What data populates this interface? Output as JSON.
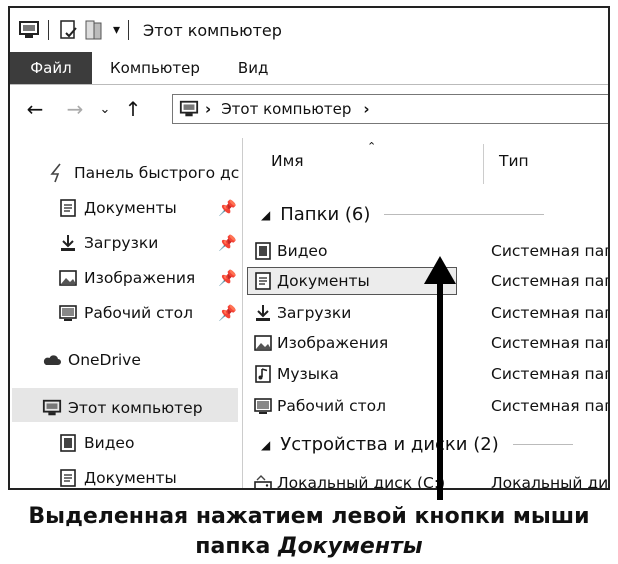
{
  "window": {
    "title": "Этот компьютер",
    "ribbon_tabs": [
      "Файл",
      "Компьютер",
      "Вид"
    ],
    "address": {
      "location": "Этот компьютер",
      "chevron": "›"
    }
  },
  "nav_pane": {
    "quick_access": "Панель быстрого дс",
    "quick_items": [
      {
        "label": "Документы",
        "icon": "documents-icon",
        "pinned": true
      },
      {
        "label": "Загрузки",
        "icon": "downloads-icon",
        "pinned": true
      },
      {
        "label": "Изображения",
        "icon": "pictures-icon",
        "pinned": true
      },
      {
        "label": "Рабочий стол",
        "icon": "desktop-icon",
        "pinned": true
      }
    ],
    "onedrive": "OneDrive",
    "this_pc": "Этот компьютер",
    "pc_items": [
      {
        "label": "Видео",
        "icon": "video-icon"
      },
      {
        "label": "Документы",
        "icon": "documents-icon"
      }
    ]
  },
  "content": {
    "columns": {
      "name": "Имя",
      "type": "Тип"
    },
    "folders_group": "Папки (6)",
    "folders": [
      {
        "name": "Видео",
        "type": "Системная папк",
        "icon": "video-icon",
        "selected": false
      },
      {
        "name": "Документы",
        "type": "Системная папк",
        "icon": "documents-icon",
        "selected": true
      },
      {
        "name": "Загрузки",
        "type": "Системная папк",
        "icon": "downloads-icon",
        "selected": false
      },
      {
        "name": "Изображения",
        "type": "Системная папк",
        "icon": "pictures-icon",
        "selected": false
      },
      {
        "name": "Музыка",
        "type": "Системная папк",
        "icon": "music-icon",
        "selected": false
      },
      {
        "name": "Рабочий стол",
        "type": "Системная папк",
        "icon": "desktop-icon",
        "selected": false
      }
    ],
    "devices_group": "Устройства и диски (2)",
    "devices": [
      {
        "name": "Локальный диск (C:)",
        "type": "Локальный дис",
        "icon": "drive-icon"
      }
    ]
  },
  "caption": {
    "line1": "Выделенная нажатием левой кнопки мыши",
    "line2_prefix": "папка ",
    "line2_italic": "Документы"
  }
}
